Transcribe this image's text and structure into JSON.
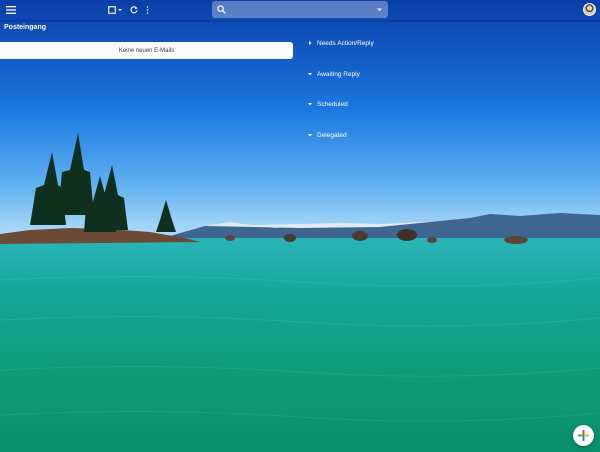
{
  "toolbar": {
    "menu_icon": "menu-icon",
    "select_icon": "checkbox-icon",
    "refresh_icon": "refresh-icon",
    "more_icon": "more-vert-icon"
  },
  "search": {
    "placeholder": "",
    "icon": "search-icon",
    "options_icon": "chevron-down-icon"
  },
  "account": {
    "avatar": "avatar"
  },
  "inbox": {
    "title": "Posteingang",
    "empty_message": "Keine neuen E-Mails"
  },
  "categories": [
    {
      "label": "Needs Action/Reply",
      "state": "collapsed"
    },
    {
      "label": "Awaiting Reply",
      "state": "expanded"
    },
    {
      "label": "Scheduled",
      "state": "expanded"
    },
    {
      "label": "Delegated",
      "state": "expanded"
    }
  ],
  "compose": {
    "icon": "plus-icon"
  },
  "colors": {
    "sky_top": "#0a3fb0",
    "sky_mid": "#1f7fe6",
    "water": "#0fa88a",
    "card_bg": "#fbfcfd"
  }
}
